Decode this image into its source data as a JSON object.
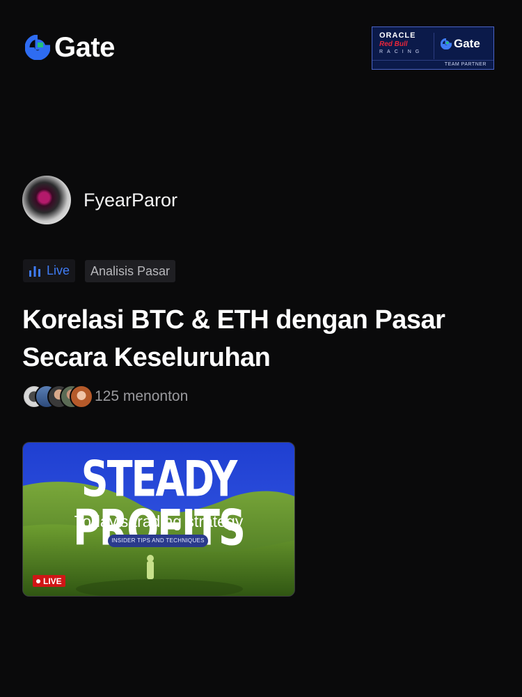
{
  "header": {
    "logo_text": "Gate",
    "partner": {
      "oracle": "ORACLE",
      "redbull": "Red Bull",
      "racing": "RACING",
      "gate": "Gate",
      "team": "TEAM PARTNER"
    }
  },
  "host": {
    "username": "FyearParor"
  },
  "tags": {
    "live": "Live",
    "category": "Analisis Pasar"
  },
  "stream": {
    "title": "Korelasi BTC & ETH dengan Pasar Secara Keseluruhan",
    "viewers": "125 menonton"
  },
  "thumbnail": {
    "headline": "STEADY PROFITS",
    "subtitle": "Today’s trading strategy",
    "pill": "INSIDER TIPS AND TECHNIQUES",
    "live_badge": "LIVE"
  },
  "colors": {
    "accent": "#3f7cf5",
    "live_red": "#d01616",
    "background": "#0a0a0b"
  }
}
